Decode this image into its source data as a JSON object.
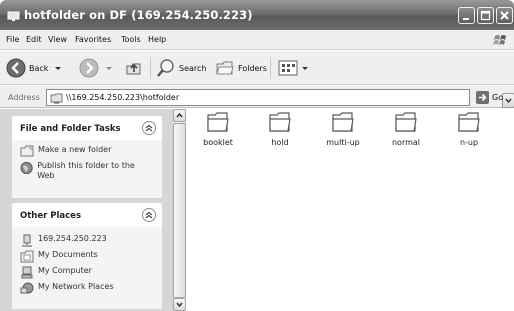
{
  "window": {
    "title": "hotfolder on DF (169.254.250.223)"
  },
  "menu": [
    "File",
    "Edit",
    "View",
    "Favorites",
    "Tools",
    "Help"
  ],
  "toolbar": {
    "back_label": "Back",
    "search_label": "Search",
    "folders_label": "Folders"
  },
  "address": {
    "label": "Address",
    "value": "\\\\169.254.250.223\\hotfolder",
    "go_label": "Go"
  },
  "tasks": {
    "title": "File and Folder Tasks",
    "items": [
      {
        "label": "Make a new folder",
        "icon": "new-folder-icon"
      },
      {
        "label": "Publish this folder to the Web",
        "icon": "globe-icon"
      }
    ]
  },
  "places": {
    "title": "Other Places",
    "items": [
      {
        "label": "169.254.250.223",
        "icon": "network-computer-icon"
      },
      {
        "label": "My Documents",
        "icon": "documents-folder-icon"
      },
      {
        "label": "My Computer",
        "icon": "computer-icon"
      },
      {
        "label": "My Network Places",
        "icon": "network-places-icon"
      }
    ]
  },
  "folders": [
    "booklet",
    "hold",
    "multi-up",
    "normal",
    "n-up"
  ],
  "colors": {
    "titlebar": "#6c6c6c",
    "taskpane": "#d6d6d6",
    "panel": "#f4f4f4"
  }
}
